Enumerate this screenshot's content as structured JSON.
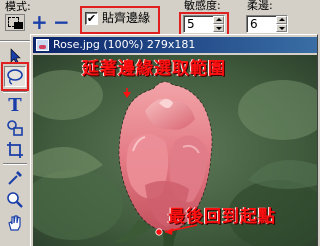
{
  "options_bar": {
    "mode_label": "模式:",
    "selection_mode_icon": "new-selection-icon",
    "add_icon": "+",
    "subtract_icon": "−",
    "snap_checked": true,
    "snap_check_mark": "✔",
    "snap_label": "貼齊邊緣",
    "sensitivity_label": "敏感度:",
    "sensitivity_value": "5",
    "softness_label": "柔邊:",
    "softness_value": "6"
  },
  "toolbox": {
    "tools": [
      {
        "name": "arrow-tool-icon"
      },
      {
        "name": "lasso-tool-icon",
        "active": true
      },
      {
        "name": "text-tool-icon",
        "glyph": "T"
      },
      {
        "name": "shape-tool-icon"
      },
      {
        "name": "crop-tool-icon"
      },
      {
        "name": "eyedropper-tool-icon"
      },
      {
        "name": "zoom-tool-icon"
      },
      {
        "name": "hand-tool-icon"
      }
    ]
  },
  "image_window": {
    "title": "Rose.jpg (100%) 279x181"
  },
  "annotations": {
    "top": "延著邊緣選取範圍",
    "bottom": "最後回到起點"
  },
  "colors": {
    "highlight_red": "#e02020",
    "annotation_red": "#ff1010",
    "title_bar_blue": "#0a246a",
    "rose_pink": "#e8737e"
  }
}
